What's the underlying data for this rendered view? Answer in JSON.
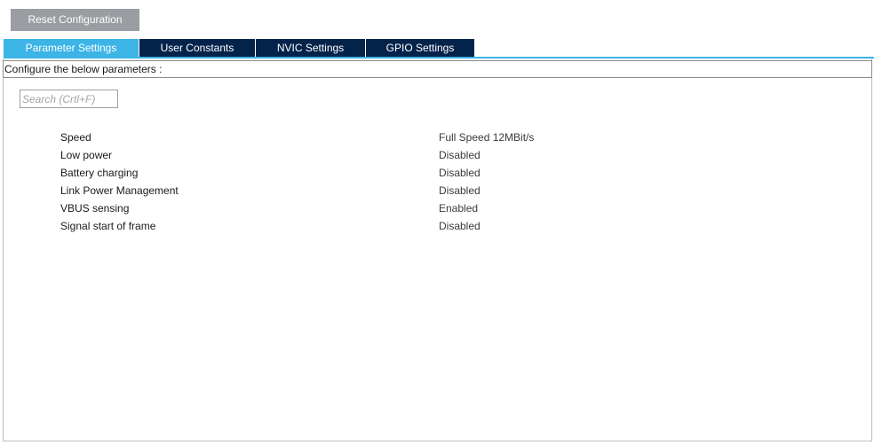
{
  "toolbar": {
    "reset_label": "Reset Configuration"
  },
  "tabs": [
    {
      "label": "Parameter Settings",
      "active": true
    },
    {
      "label": "User Constants",
      "active": false
    },
    {
      "label": "NVIC Settings",
      "active": false
    },
    {
      "label": "GPIO Settings",
      "active": false
    }
  ],
  "panel": {
    "header": "Configure the below parameters :",
    "search_placeholder": "Search (Crtl+F)"
  },
  "parameters": [
    {
      "name": "Speed",
      "value": "Full Speed 12MBit/s"
    },
    {
      "name": "Low power",
      "value": "Disabled"
    },
    {
      "name": "Battery charging",
      "value": "Disabled"
    },
    {
      "name": "Link Power Management",
      "value": "Disabled"
    },
    {
      "name": "VBUS sensing",
      "value": "Enabled"
    },
    {
      "name": "Signal start of frame",
      "value": "Disabled"
    }
  ],
  "colors": {
    "tab_active": "#3cb4e6",
    "tab_inactive": "#03234b",
    "reset_button": "#9a9da1"
  }
}
